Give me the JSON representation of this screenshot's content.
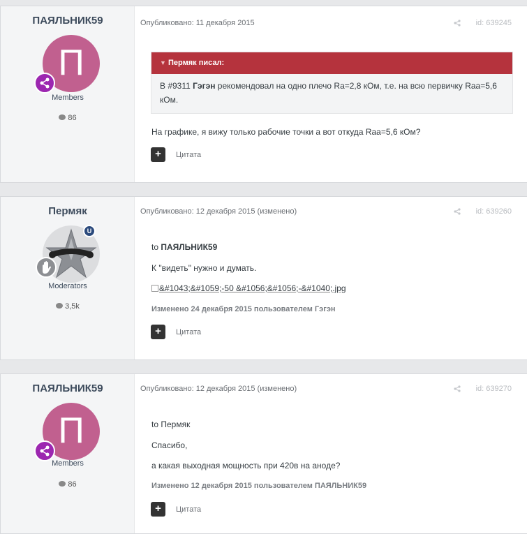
{
  "posts": [
    {
      "author": "ПАЯЛЬНИК59",
      "avatar_letter": "П",
      "group": "Members",
      "count": "86",
      "meta": "Опубликовано: 11 декабря 2015",
      "id": "id: 639245",
      "quote_author": "Пермяк писал:",
      "quote_pre": "В #9311 ",
      "quote_bold": "Гэгэн",
      "quote_post": " рекомендовал на одно плечо Ra=2,8 кОм, т.е. на всю первичку Raa=5,6 кОм.",
      "text": "На графике, я вижу только рабочие точки а вот откуда Raa=5,6 кОм?",
      "cite": "Цитата"
    },
    {
      "author": "Пермяк",
      "group": "Moderators",
      "count": "3,5k",
      "meta": "Опубликовано: 12 декабря 2015 (изменено)",
      "id": "id: 639260",
      "line1_pre": "to ",
      "line1_bold": "ПАЯЛЬНИК59",
      "line2": "К \"видеть\" нужно и думать.",
      "img_alt": "&#1043;&#1059;-50 &#1056;&#1056;-&#1040;.jpg",
      "edited": "Изменено 24 декабря 2015 пользователем Гэгэн",
      "cite": "Цитата"
    },
    {
      "author": "ПАЯЛЬНИК59",
      "avatar_letter": "П",
      "group": "Members",
      "count": "86",
      "meta": "Опубликовано: 12 декабря 2015 (изменено)",
      "id": "id: 639270",
      "line1": "to Пермяк",
      "line2": "Спасибо,",
      "line3": "а какая выходная мощность при 420в на аноде?",
      "edited": "Изменено 12 декабря 2015 пользователем ПАЯЛЬНИК59",
      "cite": "Цитата"
    }
  ]
}
